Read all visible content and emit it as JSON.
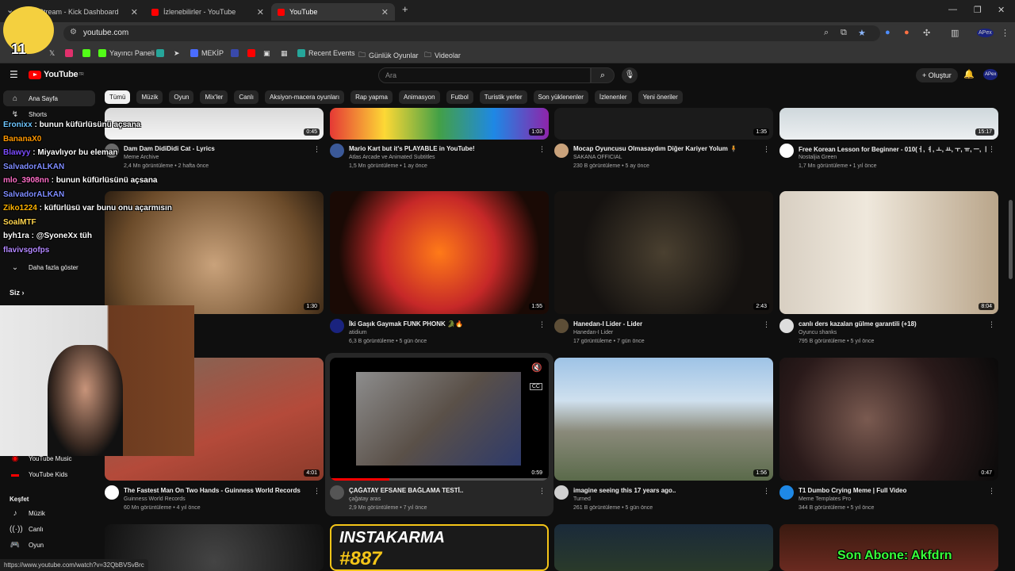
{
  "browser": {
    "tabs": [
      {
        "title": "Stream - Kick Dashboard",
        "favicon_color": "#53fc18"
      },
      {
        "title": "İzlenebilirler - YouTube",
        "favicon_color": "#ff0000"
      },
      {
        "title": "YouTube",
        "favicon_color": "#ff0000"
      }
    ],
    "url": "youtube.com",
    "profile_label": "APex",
    "bookmarks": [
      {
        "label": "Yayıncı Paneli",
        "icon_color": "#53fc18"
      },
      {
        "label": "MEKİP",
        "icon_color": "#4a6cff"
      },
      {
        "label": "Recent Events",
        "icon_color": "#26a69a"
      },
      {
        "label": "Günlük Oyunlar",
        "icon_color": "#9e9e9e"
      },
      {
        "label": "Videolar",
        "icon_color": "#9e9e9e"
      }
    ]
  },
  "youtube": {
    "logo": "YouTube",
    "logo_region": "TR",
    "search_placeholder": "Ara",
    "create_label": "Oluştur",
    "avatar_label": "APex",
    "chips": [
      "Tümü",
      "Müzik",
      "Oyun",
      "Mix'ler",
      "Canlı",
      "Aksiyon-macera oyunları",
      "Rap yapma",
      "Animasyon",
      "Futbol",
      "Turistik yerler",
      "Son yüklenenler",
      "İzlenenler",
      "Yeni öneriler"
    ],
    "sidebar": {
      "items_top": [
        {
          "label": "Ana Sayfa",
          "icon": "home-icon"
        },
        {
          "label": "Shorts",
          "icon": "shorts-icon"
        }
      ],
      "more_label": "Daha fazla göster",
      "you_label": "Siz",
      "items_mid": [
        {
          "label": "YouTube Music",
          "icon": "youtube-music-icon"
        },
        {
          "label": "YouTube Kids",
          "icon": "youtube-kids-icon"
        }
      ],
      "explore_label": "Keşfet",
      "items_explore": [
        {
          "label": "Müzik",
          "icon": "music-icon"
        },
        {
          "label": "Canlı",
          "icon": "live-icon"
        },
        {
          "label": "Oyun",
          "icon": "gaming-icon"
        }
      ]
    },
    "videos": [
      {
        "title": "Dam Dam DidiDidi Cat - Lyrics",
        "channel": "Meme Archive",
        "meta": "2,4 Mn görüntüleme • 2 hafta önce",
        "duration": "0:45",
        "avatar_color": "#6a6a6a"
      },
      {
        "title": "Mario Kart but it's PLAYABLE in YouTube!",
        "channel": "Atlas Arcade ve Animated Subtitles",
        "meta": "1,5 Mn görüntüleme • 1 ay önce",
        "duration": "1:03",
        "avatar_color": "#3b5998"
      },
      {
        "title": "Mocap Oyuncusu Olmasaydım Diğer Kariyer Yolum 🧍",
        "channel": "SAKANA OFFICIAL",
        "meta": "230 B görüntüleme • 5 ay önce",
        "duration": "1:35",
        "avatar_color": "#c9a27b"
      },
      {
        "title": "Free Korean Lesson for Beginner - 010(ㅓ, ㅕ, ㅗ, ㅛ, ㅜ, ㅠ, ㅡ, ㅣ)",
        "channel": "Nostaljia Green",
        "meta": "1,7 Mn görüntüleme • 1 yıl önce",
        "duration": "15:17",
        "avatar_color": "#ffffff"
      },
      {
        "title": "",
        "channel": "",
        "meta": "",
        "duration": "1:30",
        "avatar_color": "#888"
      },
      {
        "title": "İki Gaşık Gaymak FUNK PHONK 🐊🔥",
        "channel": "atidium",
        "meta": "6,3 B görüntüleme • 5 gün önce",
        "duration": "1:55",
        "avatar_color": "#1a237e"
      },
      {
        "title": "Hanedan-I Lider - Lider",
        "channel": "Hanedan-I Lider",
        "meta": "17 görüntüleme • 7 gün önce",
        "duration": "2:43",
        "avatar_color": "#5d4e37"
      },
      {
        "title": "canlı ders kazalan gülme garantili (+18)",
        "channel": "Oyuncu shanks",
        "meta": "795 B görüntüleme • 5 yıl önce",
        "duration": "8:04",
        "avatar_color": "#dddddd"
      },
      {
        "title": "The Fastest Man On Two Hands - Guinness World Records",
        "channel": "Guinness World Records",
        "meta": "60 Mn görüntüleme • 4 yıl önce",
        "duration": "4:01",
        "avatar_color": "#ffffff"
      },
      {
        "title": "ÇAĞATAY EFSANE BAĞLAMA TESTİ..",
        "channel": "çağatay aras",
        "meta": "2,9 Mn görüntüleme • 7 yıl önce",
        "duration": "0:59",
        "avatar_color": "#555"
      },
      {
        "title": "imagine seeing this 17 years ago..",
        "channel": "Turned",
        "meta": "261 B görüntüleme • 5 gün önce",
        "duration": "1:56",
        "avatar_color": "#cfcfcf"
      },
      {
        "title": "T1 Dumbo Crying Meme | Full Video",
        "channel": "Meme Templates Pro",
        "meta": "344 B görüntüleme • 5 yıl önce",
        "duration": "0:47",
        "avatar_color": "#1e88e5"
      }
    ],
    "bottom_thumb_text": [
      "INSTAKARMA",
      "#887"
    ]
  },
  "overlay": {
    "chat": [
      {
        "user": "Eronixx",
        "msg": "bunun küfürlüsünü açsana",
        "color": "#6ec6ff"
      },
      {
        "user": "BananaX0",
        "msg": "",
        "color": "#ff9800"
      },
      {
        "user": "Blawyy",
        "msg": "Miyavlıyor bu eleman",
        "color": "#7c4dff"
      },
      {
        "user": "SalvadorALKAN",
        "msg": "",
        "color": "#7e8cff"
      },
      {
        "user": "mlo_3908nn",
        "msg": "bunun küfürlüsünü açsana",
        "color": "#ff6ec7"
      },
      {
        "user": "SalvadorALKAN",
        "msg": "",
        "color": "#7e8cff"
      },
      {
        "user": "Ziko1224",
        "msg": "küfürlüsü var bunu onu açarmısın",
        "color": "#ffb300"
      },
      {
        "user": "SoalMTF",
        "msg": "",
        "color": "#ffd54f"
      },
      {
        "user": "byh1ra",
        "msg": "@SyoneXx tüh",
        "color": "#ffffff"
      },
      {
        "user": "flavivsgofps",
        "msg": "",
        "color": "#b388ff"
      }
    ],
    "subscriber_banner": "Son Abone: Akfdrn",
    "status_url": "https://www.youtube.com/watch?v=32QbBVSvBrc",
    "unread_badge": "11"
  }
}
